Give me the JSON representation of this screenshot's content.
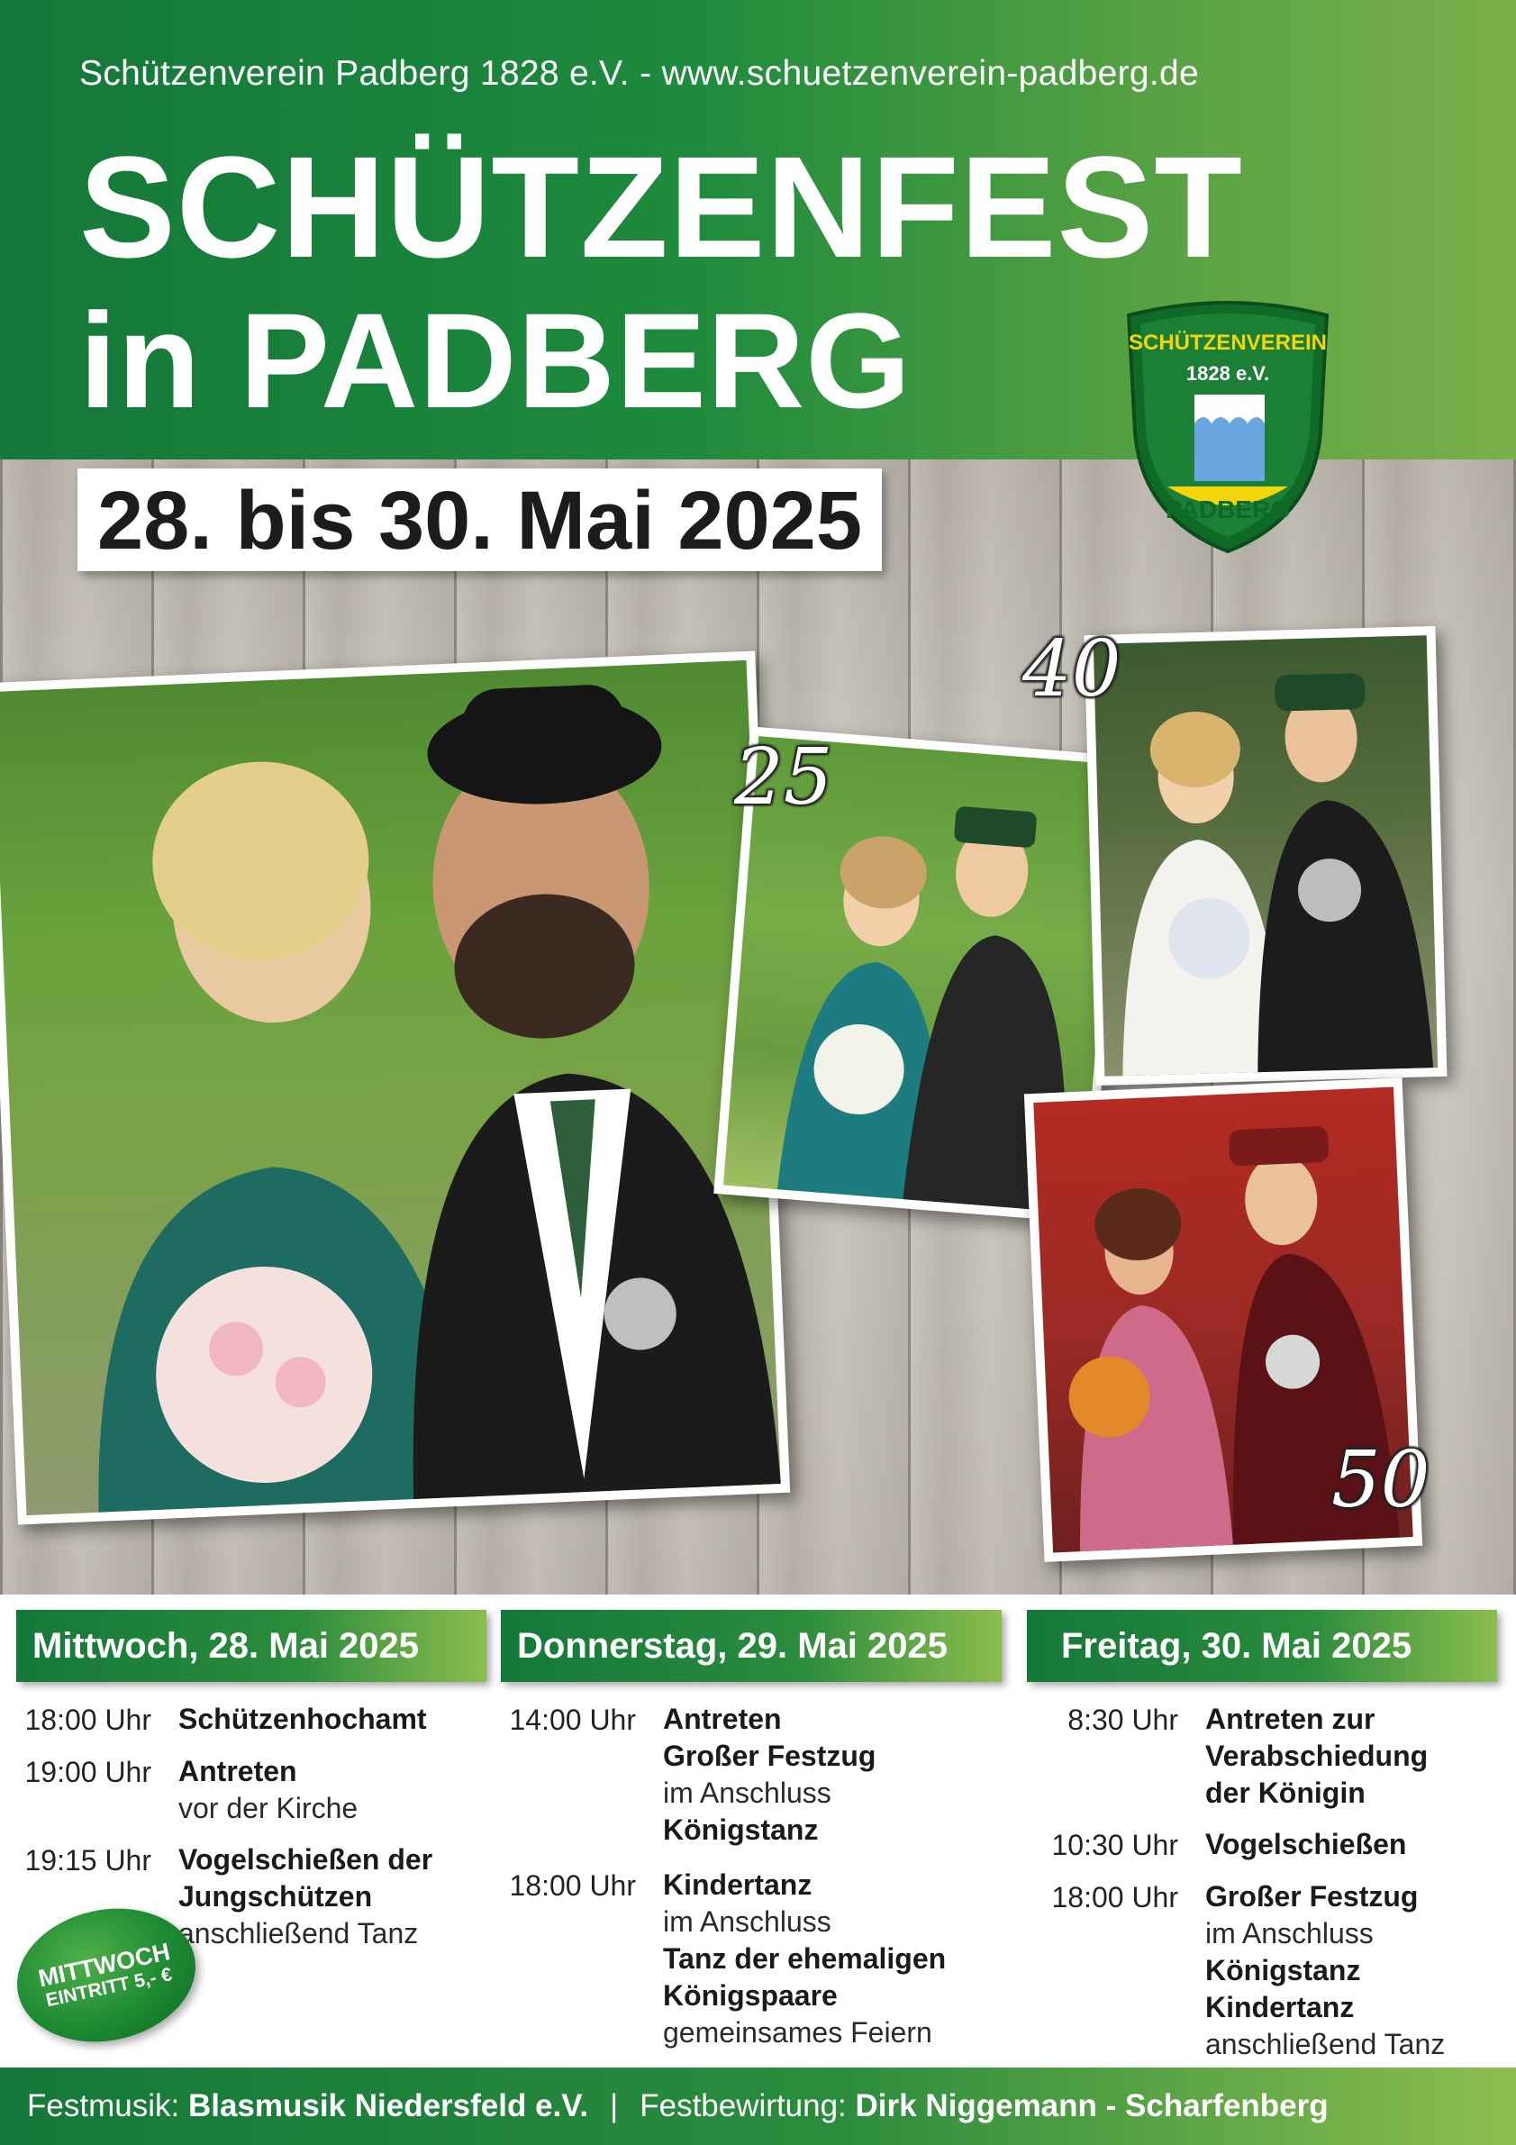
{
  "header": {
    "club_line": "Schützenverein Padberg 1828 e.V. - www.schuetzenverein-padberg.de",
    "title_line1": "SCHÜTZENFEST",
    "title_line2": "in PADBERG",
    "dates": "28. bis 30. Mai 2025"
  },
  "badge": {
    "top_text": "SCHÜTZENVEREIN",
    "year_text": "1828 e.V.",
    "bottom_text": "PADBERG"
  },
  "photos": {
    "anniversary_25": "25",
    "anniversary_40": "40",
    "anniversary_50": "50"
  },
  "schedule": [
    {
      "day": "Mittwoch, 28. Mai 2025",
      "events": [
        {
          "time": "18:00 Uhr",
          "lines": [
            {
              "t": "Schützenhochamt",
              "bold": true
            }
          ]
        },
        {
          "time": "19:00 Uhr",
          "lines": [
            {
              "t": "Antreten",
              "bold": true
            },
            {
              "t": "vor der Kirche",
              "bold": false
            }
          ]
        },
        {
          "time": "19:15 Uhr",
          "lines": [
            {
              "t": "Vogelschießen der",
              "bold": true
            },
            {
              "t": "Jungschützen",
              "bold": true
            },
            {
              "t": "anschließend Tanz",
              "bold": false
            }
          ]
        }
      ]
    },
    {
      "day": "Donnerstag, 29. Mai 2025",
      "events": [
        {
          "time": "14:00 Uhr",
          "lines": [
            {
              "t": "Antreten",
              "bold": true
            },
            {
              "t": "Großer Festzug",
              "bold": true
            },
            {
              "t": "im Anschluss",
              "bold": false
            },
            {
              "t": "Königstanz",
              "bold": true
            }
          ]
        },
        {
          "time": "18:00 Uhr",
          "lines": [
            {
              "t": "Kindertanz",
              "bold": true
            },
            {
              "t": "im Anschluss",
              "bold": false
            },
            {
              "t": "Tanz der ehemaligen",
              "bold": true
            },
            {
              "t": "Königspaare",
              "bold": true
            },
            {
              "t": "gemeinsames Feiern",
              "bold": false
            }
          ]
        }
      ]
    },
    {
      "day": "Freitag, 30. Mai 2025",
      "events": [
        {
          "time": "8:30 Uhr",
          "lines": [
            {
              "t": "Antreten zur",
              "bold": true
            },
            {
              "t": "Verabschiedung",
              "bold": true
            },
            {
              "t": "der Königin",
              "bold": true
            }
          ]
        },
        {
          "time": "10:30 Uhr",
          "lines": [
            {
              "t": "Vogelschießen",
              "bold": true
            }
          ]
        },
        {
          "time": "18:00 Uhr",
          "lines": [
            {
              "t": "Großer Festzug",
              "bold": true
            },
            {
              "t": "im Anschluss",
              "bold": false
            },
            {
              "t": "Königstanz",
              "bold": true
            },
            {
              "t": "Kindertanz",
              "bold": true
            },
            {
              "t": "anschließend Tanz",
              "bold": false
            }
          ]
        }
      ]
    }
  ],
  "entry_badge": {
    "line1": "MITTWOCH",
    "line2": "EINTRITT 5,- €"
  },
  "footer": {
    "music_label": "Festmusik:",
    "music_value": "Blasmusik Niedersfeld e.V.",
    "separator": "|",
    "catering_label": "Festbewirtung:",
    "catering_value": "Dirk Niggemann - Scharfenberg"
  },
  "colors": {
    "brand_green": "#14783a",
    "light_green": "#8dbd4f",
    "badge_blue": "#6aa6e0"
  }
}
